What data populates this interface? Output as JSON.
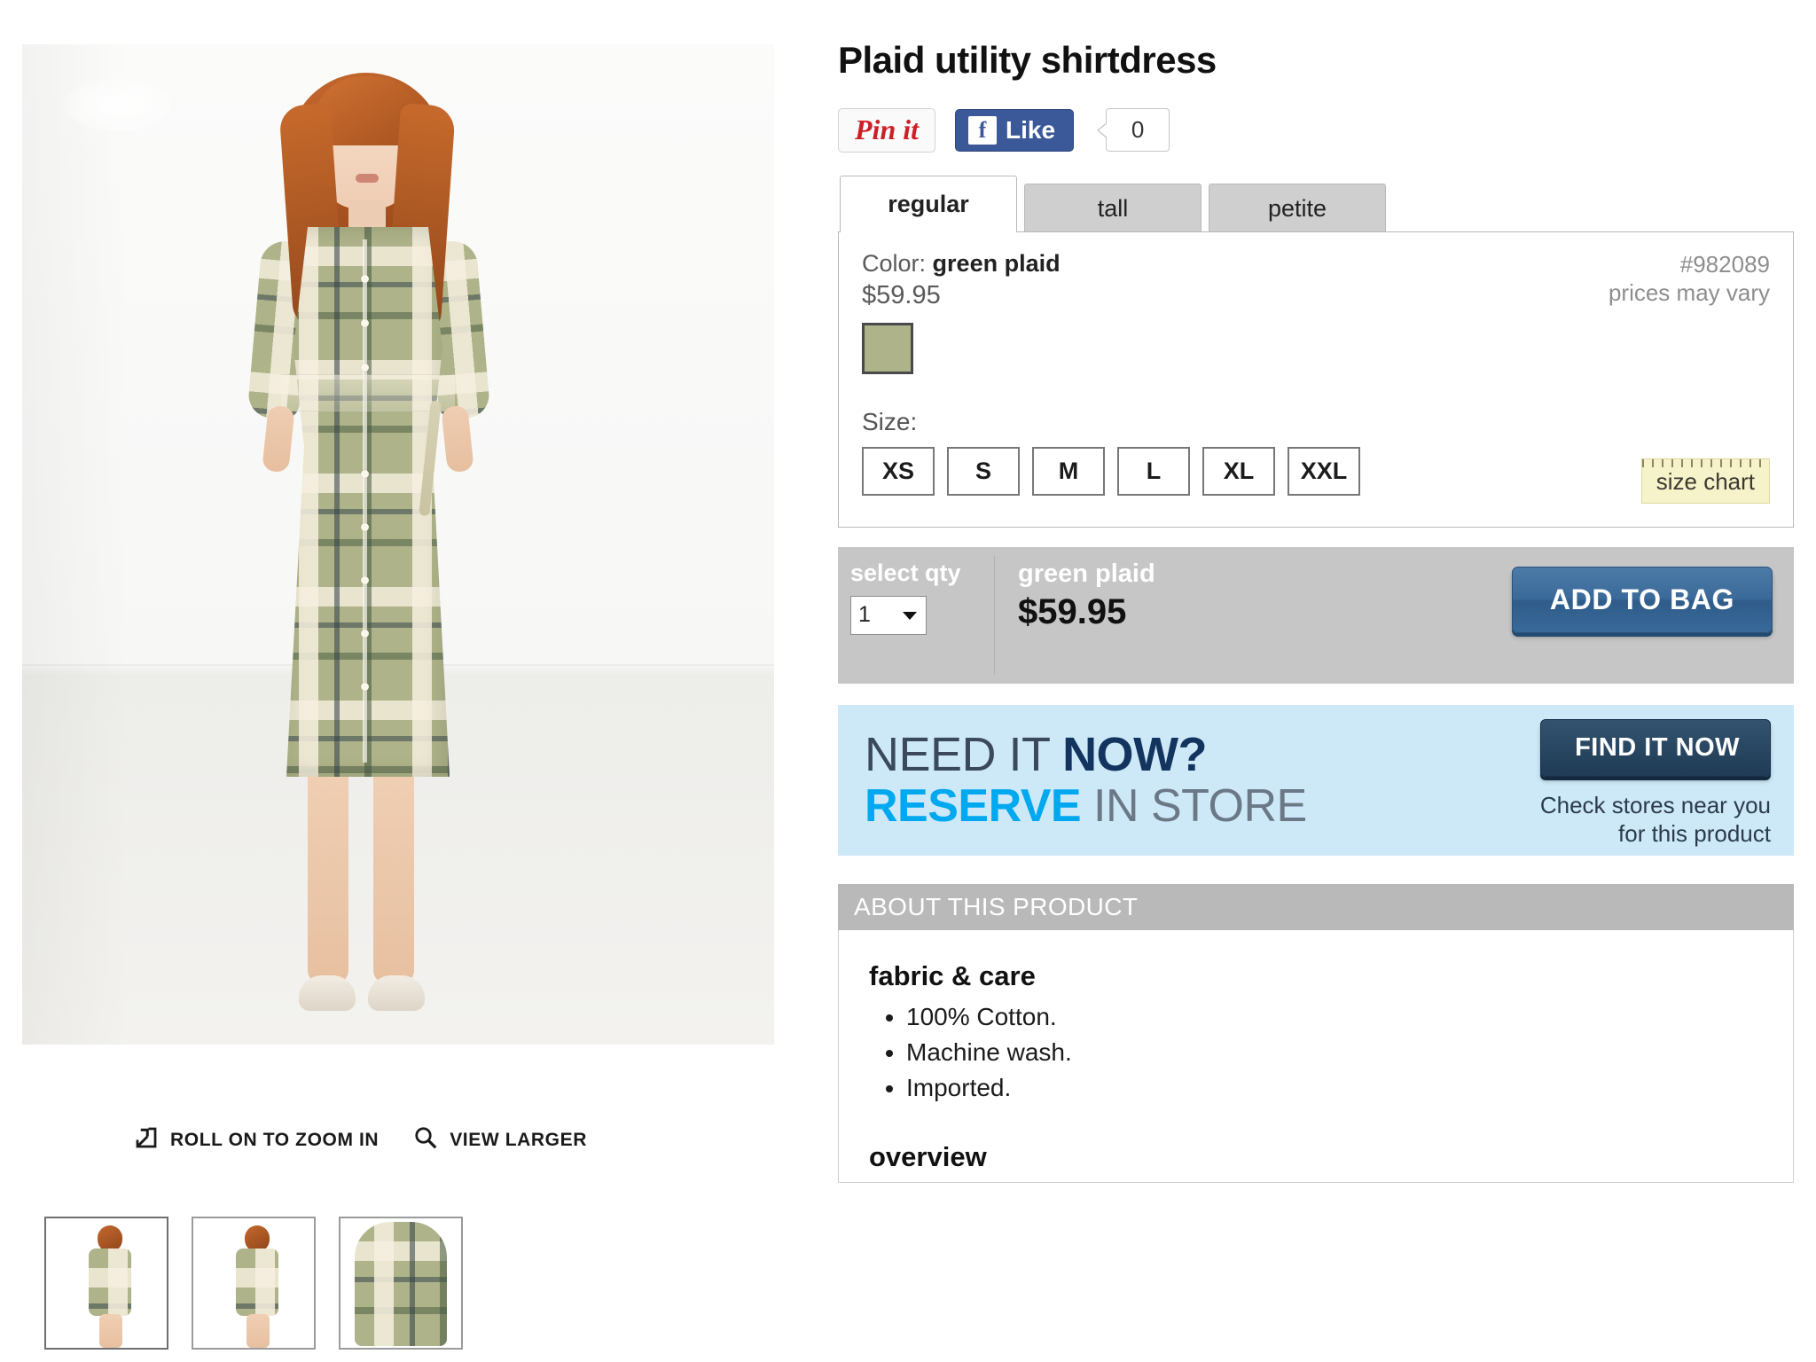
{
  "product": {
    "title": "Plaid utility shirtdress",
    "item_number": "#982089",
    "prices_note": "prices may vary",
    "color_label": "Color:",
    "color_name": "green plaid",
    "price": "$59.95",
    "size_label": "Size:",
    "sizes": [
      "XS",
      "S",
      "M",
      "L",
      "XL",
      "XXL"
    ],
    "size_chart_label": "size chart"
  },
  "social": {
    "pinit_label": "Pin it",
    "facebook_glyph": "f",
    "facebook_label": "Like",
    "like_count": "0"
  },
  "tabs": [
    {
      "label": "regular",
      "active": true
    },
    {
      "label": "tall",
      "active": false
    },
    {
      "label": "petite",
      "active": false
    }
  ],
  "buy_bar": {
    "qty_label": "select qty",
    "qty_value": "1",
    "color_name": "green plaid",
    "price": "$59.95",
    "add_to_bag_label": "ADD TO BAG"
  },
  "need_it_now": {
    "line1_a": "NEED IT ",
    "line1_b": "NOW?",
    "line2_a": "RESERVE",
    "line2_b": " IN STORE",
    "button_label": "FIND IT NOW",
    "note_line1": "Check stores near you",
    "note_line2": "for this product"
  },
  "about": {
    "header": "ABOUT THIS PRODUCT",
    "fabric_heading": "fabric & care",
    "fabric_items": [
      "100% Cotton.",
      "Machine wash.",
      "Imported."
    ],
    "overview_heading": "overview"
  },
  "image_tools": {
    "zoom_label": "ROLL ON TO ZOOM IN",
    "view_larger_label": "VIEW LARGER"
  },
  "colors": {
    "accent_blue": "#3a6a99",
    "facebook_blue": "#3b5998",
    "pinterest_red": "#cb2027",
    "banner_bg": "#cde9f8",
    "reserve_cyan": "#00a9ef",
    "bar_gray": "#c6c6c6"
  }
}
